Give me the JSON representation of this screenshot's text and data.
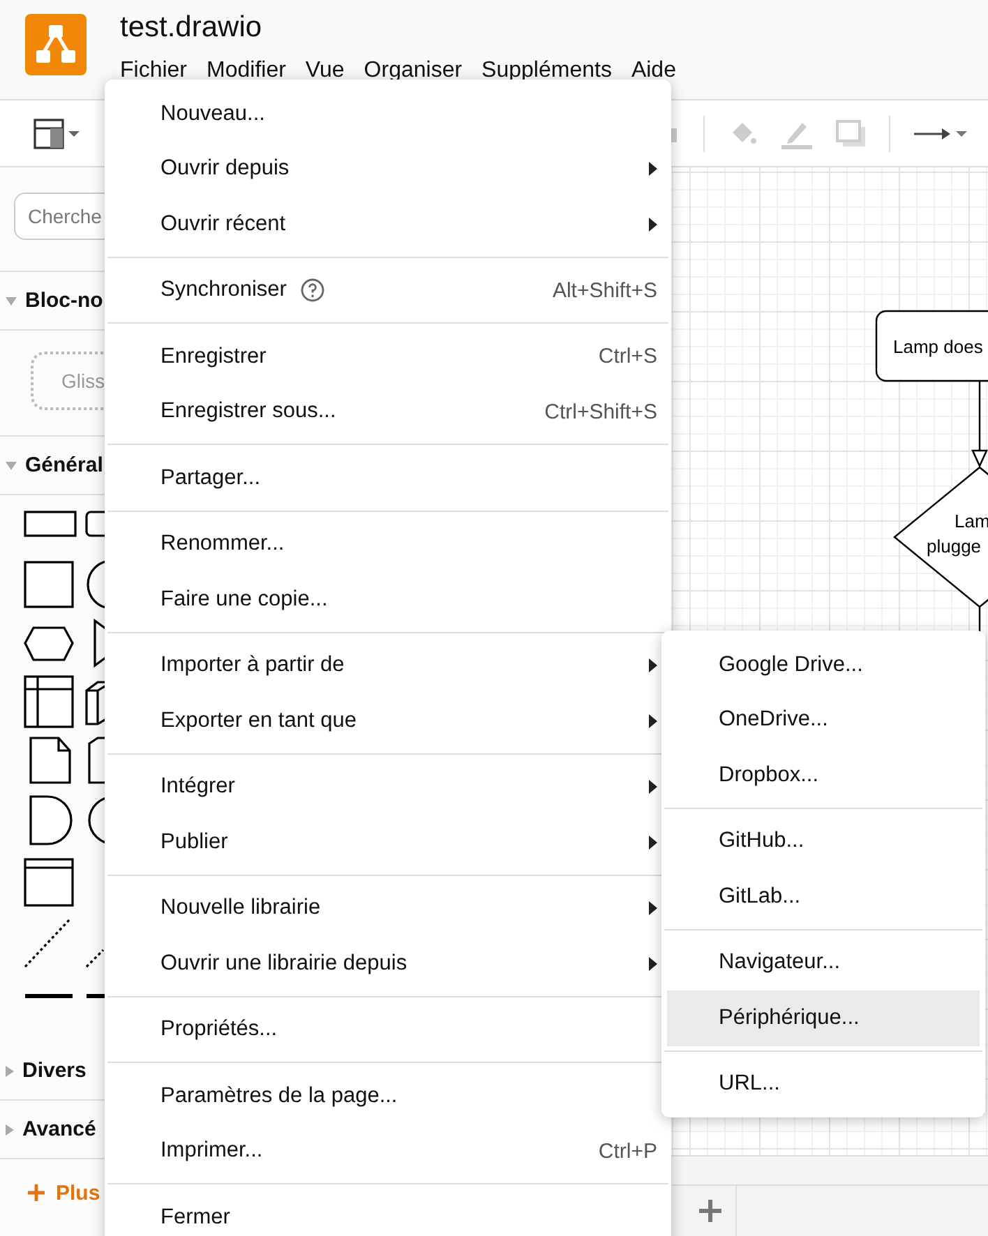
{
  "app": {
    "title": "test.drawio",
    "menus": [
      {
        "label": "Fichier"
      },
      {
        "label": "Modifier"
      },
      {
        "label": "Vue"
      },
      {
        "label": "Organiser"
      },
      {
        "label": "Suppléments"
      },
      {
        "label": "Aide"
      }
    ]
  },
  "sidebar": {
    "search": {
      "placeholder": "Cherche"
    },
    "scratchpad": {
      "label": "Bloc-no",
      "expanded": true,
      "hint": "Gliss"
    },
    "general": {
      "label": "Général",
      "expanded": true
    },
    "sections": [
      {
        "label": "Divers",
        "expanded": false
      },
      {
        "label": "Avancé",
        "expanded": false
      }
    ],
    "more_button": "Plus"
  },
  "canvas": {
    "nodes": [
      {
        "kind": "process",
        "lines": [
          "Lamp does"
        ]
      },
      {
        "kind": "decision",
        "lines": [
          "Lam",
          "plugge"
        ]
      }
    ]
  },
  "file_menu": {
    "sections": [
      [
        {
          "label": "Nouveau...",
          "submenu": false
        },
        {
          "label": "Ouvrir depuis",
          "submenu": true
        },
        {
          "label": "Ouvrir récent",
          "submenu": true
        }
      ],
      [
        {
          "label": "Synchroniser",
          "help": true,
          "shortcut": "Alt+Shift+S",
          "submenu": false
        }
      ],
      [
        {
          "label": "Enregistrer",
          "shortcut": "Ctrl+S",
          "submenu": false
        },
        {
          "label": "Enregistrer sous...",
          "shortcut": "Ctrl+Shift+S",
          "submenu": false
        }
      ],
      [
        {
          "label": "Partager...",
          "submenu": false
        }
      ],
      [
        {
          "label": "Renommer...",
          "submenu": false
        },
        {
          "label": "Faire une copie...",
          "submenu": false
        }
      ],
      [
        {
          "label": "Importer à partir de",
          "submenu": true
        },
        {
          "label": "Exporter en tant que",
          "submenu": true
        }
      ],
      [
        {
          "label": "Intégrer",
          "submenu": true
        },
        {
          "label": "Publier",
          "submenu": true
        }
      ],
      [
        {
          "label": "Nouvelle librairie",
          "submenu": true
        },
        {
          "label": "Ouvrir une librairie depuis",
          "submenu": true
        }
      ],
      [
        {
          "label": "Propriétés...",
          "submenu": false
        }
      ],
      [
        {
          "label": "Paramètres de la page...",
          "submenu": false
        },
        {
          "label": "Imprimer...",
          "shortcut": "Ctrl+P",
          "submenu": false
        }
      ],
      [
        {
          "label": "Fermer",
          "submenu": false
        }
      ]
    ]
  },
  "submenu": {
    "sections": [
      [
        {
          "label": "Google Drive...",
          "selected": false
        },
        {
          "label": "OneDrive...",
          "selected": false
        },
        {
          "label": "Dropbox...",
          "selected": false
        }
      ],
      [
        {
          "label": "GitHub...",
          "selected": false
        },
        {
          "label": "GitLab...",
          "selected": false
        }
      ],
      [
        {
          "label": "Navigateur...",
          "selected": false
        },
        {
          "label": "Périphérique...",
          "selected": true
        }
      ],
      [
        {
          "label": "URL...",
          "selected": false
        }
      ]
    ]
  }
}
